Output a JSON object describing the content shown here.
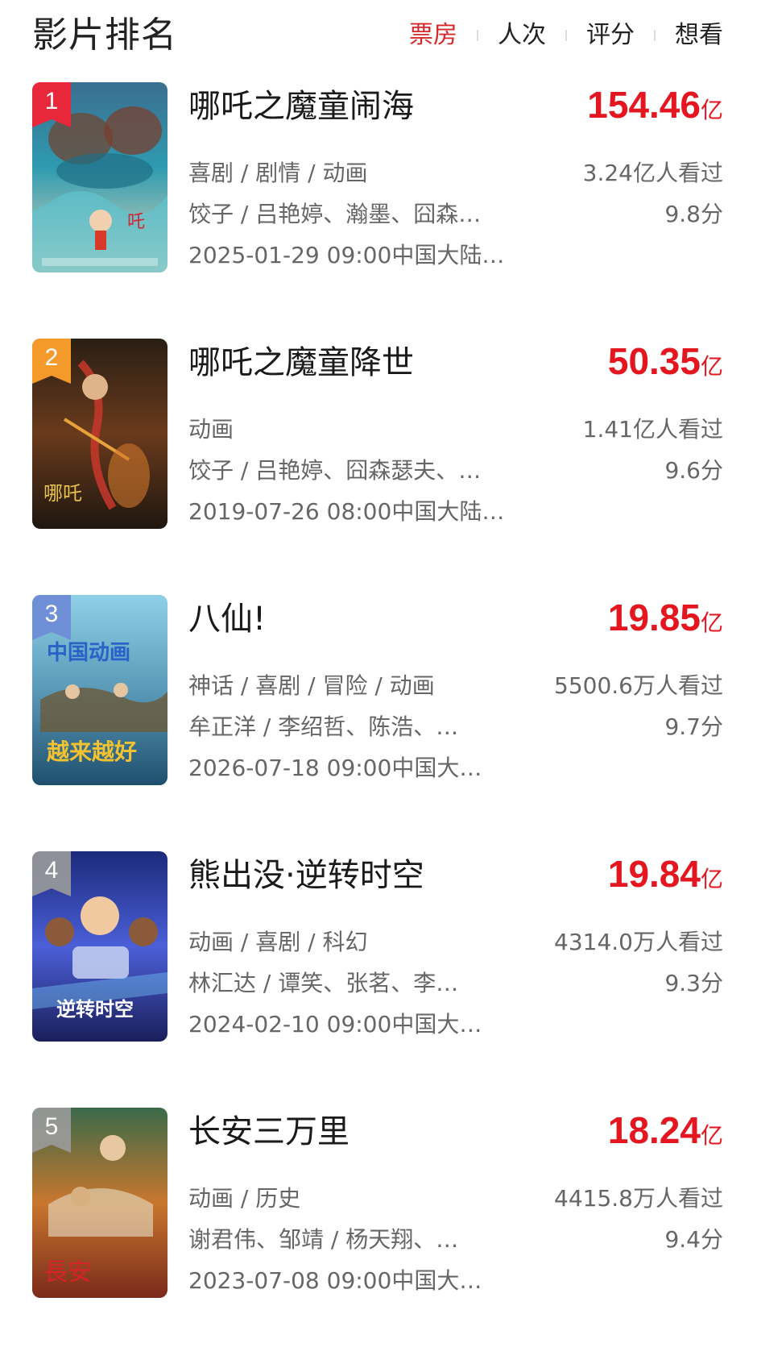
{
  "header": {
    "title": "影片排名",
    "tabs": [
      {
        "label": "票房",
        "active": true
      },
      {
        "label": "人次",
        "active": false
      },
      {
        "label": "评分",
        "active": false
      },
      {
        "label": "想看",
        "active": false
      }
    ]
  },
  "colors": {
    "accent": "#e4161f",
    "rank1": "#e8283a",
    "rank2": "#f39a2b",
    "rank3": "#6f8fd6",
    "rank_other": "#9b9b9b"
  },
  "movies": [
    {
      "rank": "1",
      "title": "哪吒之魔童闹海",
      "box_office": "154.46",
      "box_office_unit": "亿",
      "genres": "喜剧 / 剧情 / 动画",
      "viewers": "3.24亿人看过",
      "cast": "饺子 / 吕艳婷、瀚墨、囧森…",
      "score": "9.8分",
      "release": "2025-01-29 09:00中国大陆…"
    },
    {
      "rank": "2",
      "title": "哪吒之魔童降世",
      "box_office": "50.35",
      "box_office_unit": "亿",
      "genres": "动画",
      "viewers": "1.41亿人看过",
      "cast": "饺子 / 吕艳婷、囧森瑟夫、…",
      "score": "9.6分",
      "release": "2019-07-26 08:00中国大陆…"
    },
    {
      "rank": "3",
      "title": "八仙!",
      "box_office": "19.85",
      "box_office_unit": "亿",
      "genres": "神话 / 喜剧 / 冒险 / 动画",
      "viewers": "5500.6万人看过",
      "cast": "牟正洋 / 李绍哲、陈浩、…",
      "score": "9.7分",
      "release": "2026-07-18 09:00中国大…"
    },
    {
      "rank": "4",
      "title": "熊出没·逆转时空",
      "box_office": "19.84",
      "box_office_unit": "亿",
      "genres": "动画 / 喜剧 / 科幻",
      "viewers": "4314.0万人看过",
      "cast": "林汇达 / 谭笑、张茗、李…",
      "score": "9.3分",
      "release": "2024-02-10 09:00中国大…"
    },
    {
      "rank": "5",
      "title": "长安三万里",
      "box_office": "18.24",
      "box_office_unit": "亿",
      "genres": "动画 / 历史",
      "viewers": "4415.8万人看过",
      "cast": "谢君伟、邹靖 / 杨天翔、…",
      "score": "9.4分",
      "release": "2023-07-08 09:00中国大…"
    }
  ]
}
